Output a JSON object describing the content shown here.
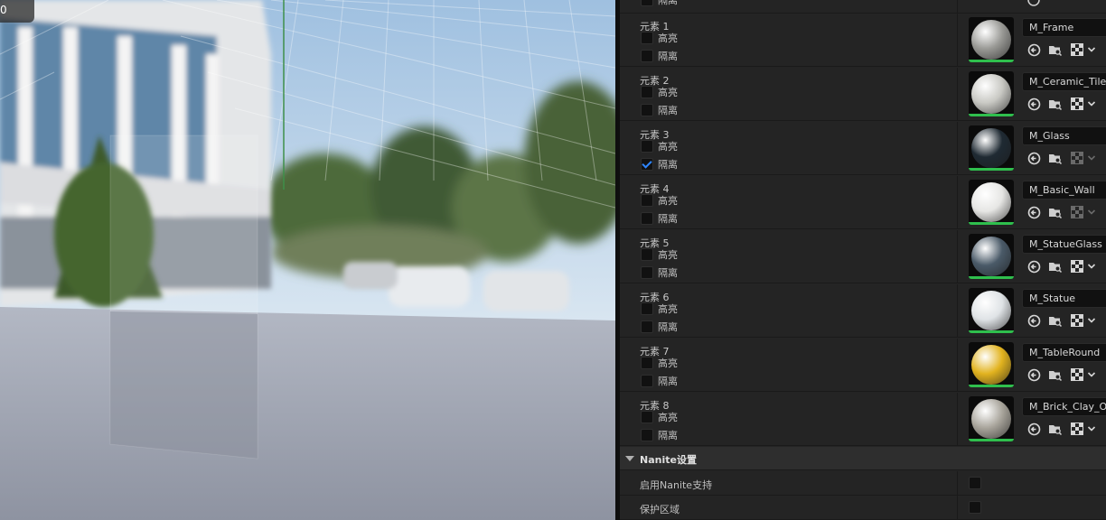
{
  "viewport": {
    "corner_button_glyph": "0"
  },
  "top_partial": {
    "isolate_label": "隔离"
  },
  "elements": [
    {
      "label": "元素 1",
      "highlight_label": "高亮",
      "isolate_label": "隔离",
      "highlight_checked": false,
      "isolate_checked": false,
      "material": "M_Frame",
      "ball_color": "#9a9a96",
      "sync_enabled": true
    },
    {
      "label": "元素 2",
      "highlight_label": "高亮",
      "isolate_label": "隔离",
      "highlight_checked": false,
      "isolate_checked": false,
      "material": "M_Ceramic_Tile_",
      "ball_color": "#c9c9c4",
      "sync_enabled": true
    },
    {
      "label": "元素 3",
      "highlight_label": "高亮",
      "isolate_label": "隔离",
      "highlight_checked": false,
      "isolate_checked": true,
      "material": "M_Glass",
      "ball_color": "#1f2a33",
      "sync_enabled": false
    },
    {
      "label": "元素 4",
      "highlight_label": "高亮",
      "isolate_label": "隔离",
      "highlight_checked": false,
      "isolate_checked": false,
      "material": "M_Basic_Wall",
      "ball_color": "#e6e6e4",
      "sync_enabled": false
    },
    {
      "label": "元素 5",
      "highlight_label": "高亮",
      "isolate_label": "隔离",
      "highlight_checked": false,
      "isolate_checked": false,
      "material": "M_StatueGlass",
      "ball_color": "#4a5a68",
      "sync_enabled": true
    },
    {
      "label": "元素 6",
      "highlight_label": "高亮",
      "isolate_label": "隔离",
      "highlight_checked": false,
      "isolate_checked": false,
      "material": "M_Statue",
      "ball_color": "#dfe3e6",
      "sync_enabled": true
    },
    {
      "label": "元素 7",
      "highlight_label": "高亮",
      "isolate_label": "隔离",
      "highlight_checked": false,
      "isolate_checked": false,
      "material": "M_TableRound",
      "ball_color": "#e2b31f",
      "sync_enabled": true
    },
    {
      "label": "元素 8",
      "highlight_label": "高亮",
      "isolate_label": "隔离",
      "highlight_checked": false,
      "isolate_checked": false,
      "material": "M_Brick_Clay_Ol",
      "ball_color": "#a9a59c",
      "sync_enabled": true
    }
  ],
  "nanite": {
    "title": "Nanite设置",
    "props": [
      {
        "name": "启用Nanite支持",
        "checked": false
      },
      {
        "name": "保护区域",
        "checked": false
      }
    ]
  },
  "icons": {
    "use_selected": "arrow-left-circle-icon",
    "browse": "folder-search-icon",
    "sync": "checker-icon",
    "dropdown": "chevron-down-icon"
  }
}
